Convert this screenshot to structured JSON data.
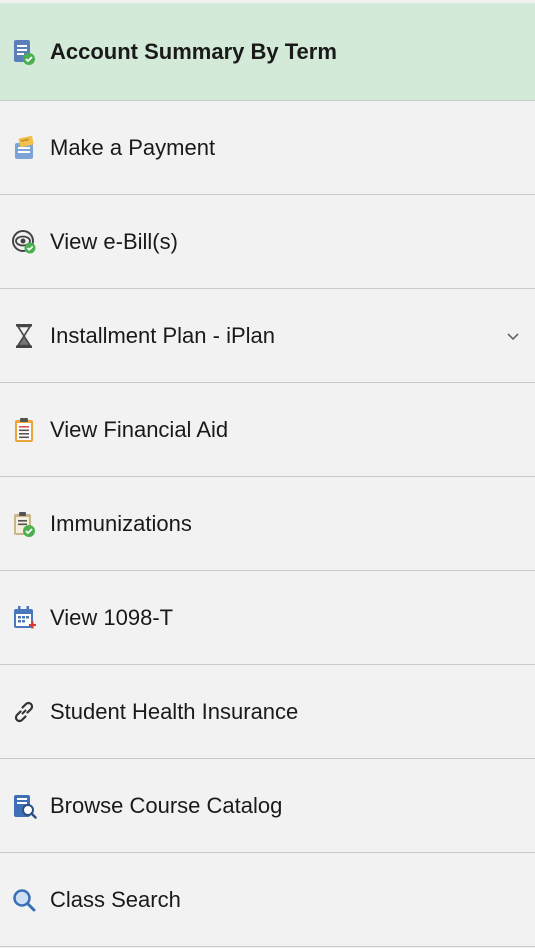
{
  "nav": {
    "items": [
      {
        "label": "Account Summary By Term",
        "icon": "account-summary-icon",
        "active": true
      },
      {
        "label": "Make a Payment",
        "icon": "payment-icon"
      },
      {
        "label": "View e-Bill(s)",
        "icon": "view-ebill-icon"
      },
      {
        "label": "Installment Plan - iPlan",
        "icon": "hourglass-icon",
        "expandable": true
      },
      {
        "label": "View Financial Aid",
        "icon": "clipboard-list-icon"
      },
      {
        "label": "Immunizations",
        "icon": "clipboard-check-icon"
      },
      {
        "label": "View 1098-T",
        "icon": "calendar-add-icon"
      },
      {
        "label": "Student Health Insurance",
        "icon": "link-icon"
      },
      {
        "label": "Browse Course Catalog",
        "icon": "catalog-search-icon"
      },
      {
        "label": "Class Search",
        "icon": "search-icon"
      }
    ]
  },
  "colors": {
    "active_bg": "#d4ead8",
    "item_bg": "#f2f2f2",
    "divider": "#c9c9c9",
    "check_green": "#4caf50"
  }
}
